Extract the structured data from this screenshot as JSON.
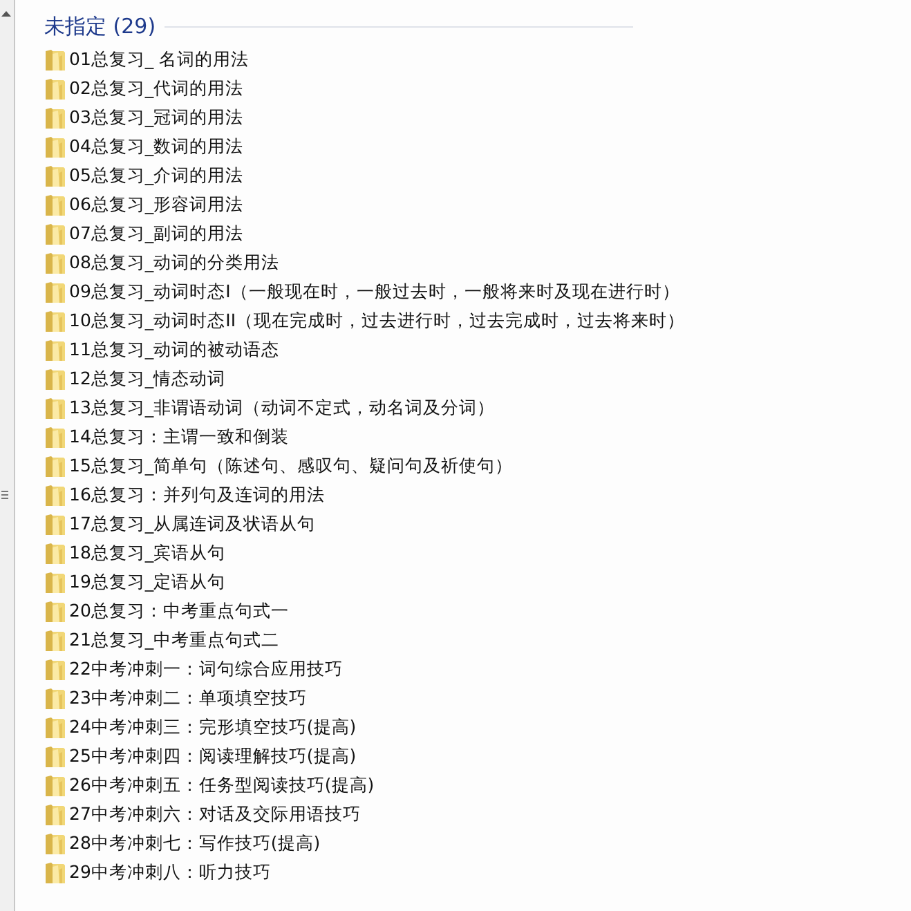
{
  "group": {
    "title": "未指定 (29)"
  },
  "items": [
    {
      "name": "01总复习_ 名词的用法"
    },
    {
      "name": "02总复习_代词的用法"
    },
    {
      "name": "03总复习_冠词的用法"
    },
    {
      "name": "04总复习_数词的用法"
    },
    {
      "name": "05总复习_介词的用法"
    },
    {
      "name": "06总复习_形容词用法"
    },
    {
      "name": "07总复习_副词的用法"
    },
    {
      "name": "08总复习_动词的分类用法"
    },
    {
      "name": "09总复习_动词时态I（一般现在时，一般过去时，一般将来时及现在进行时）"
    },
    {
      "name": "10总复习_动词时态II（现在完成时，过去进行时，过去完成时，过去将来时）"
    },
    {
      "name": "11总复习_动词的被动语态"
    },
    {
      "name": "12总复习_情态动词"
    },
    {
      "name": "13总复习_非谓语动词（动词不定式，动名词及分词）"
    },
    {
      "name": "14总复习：主谓一致和倒装"
    },
    {
      "name": "15总复习_简单句（陈述句、感叹句、疑问句及祈使句）"
    },
    {
      "name": "16总复习：并列句及连词的用法"
    },
    {
      "name": "17总复习_从属连词及状语从句"
    },
    {
      "name": "18总复习_宾语从句"
    },
    {
      "name": "19总复习_定语从句"
    },
    {
      "name": "20总复习：中考重点句式一"
    },
    {
      "name": "21总复习_中考重点句式二"
    },
    {
      "name": "22中考冲刺一：词句综合应用技巧"
    },
    {
      "name": "23中考冲刺二：单项填空技巧"
    },
    {
      "name": "24中考冲刺三：完形填空技巧(提高)"
    },
    {
      "name": "25中考冲刺四：阅读理解技巧(提高)"
    },
    {
      "name": "26中考冲刺五：任务型阅读技巧(提高)"
    },
    {
      "name": "27中考冲刺六：对话及交际用语技巧"
    },
    {
      "name": "28中考冲刺七：写作技巧(提高)"
    },
    {
      "name": "29中考冲刺八：听力技巧"
    }
  ]
}
